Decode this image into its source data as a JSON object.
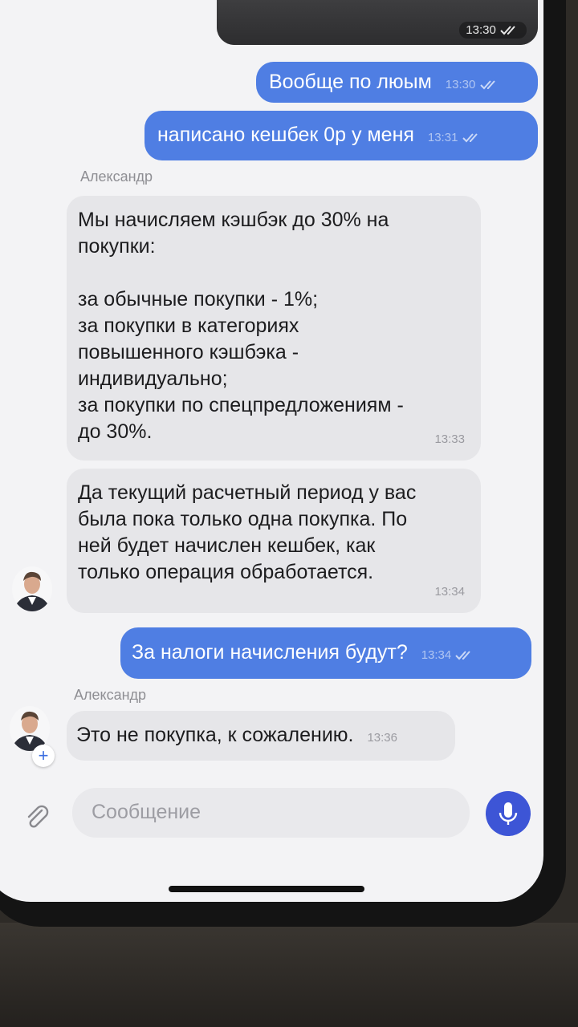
{
  "messages": [
    {
      "type": "media",
      "time": "13:30"
    },
    {
      "type": "outgoing",
      "text": "Вообще по люым",
      "time": "13:30"
    },
    {
      "type": "outgoing",
      "text": "написано кешбек 0р у меня",
      "time": "13:31"
    },
    {
      "type": "incoming",
      "sender": "Александр",
      "lines": [
        "Мы начисляем кэшбэк до 30% на",
        "покупки:",
        "",
        "за обычные покупки - 1%;",
        "за покупки в категориях",
        "повышенного кэшбэка -",
        "индивидуально;",
        "за покупки по спецпредложениям -",
        "до 30%."
      ],
      "time": "13:33"
    },
    {
      "type": "incoming",
      "lines": [
        "Да текущий расчетный период у вас",
        "была пока только одна покупка. По",
        "ней будет начислен кешбек, как",
        "только операция обработается."
      ],
      "time": "13:34"
    },
    {
      "type": "outgoing",
      "text": "За налоги начисления будут?",
      "time": "13:34"
    },
    {
      "type": "incoming",
      "sender": "Александр",
      "text": "Это не покупка, к сожалению.",
      "time": "13:36"
    }
  ],
  "composer": {
    "placeholder": "Сообщение"
  },
  "icons": {
    "attach": "paperclip-icon",
    "mic": "microphone-icon",
    "read": "double-check-icon",
    "add": "plus-icon"
  },
  "colors": {
    "outgoing": "#4f7ee3",
    "incoming": "#e6e6e9",
    "mic": "#3d55d6"
  }
}
